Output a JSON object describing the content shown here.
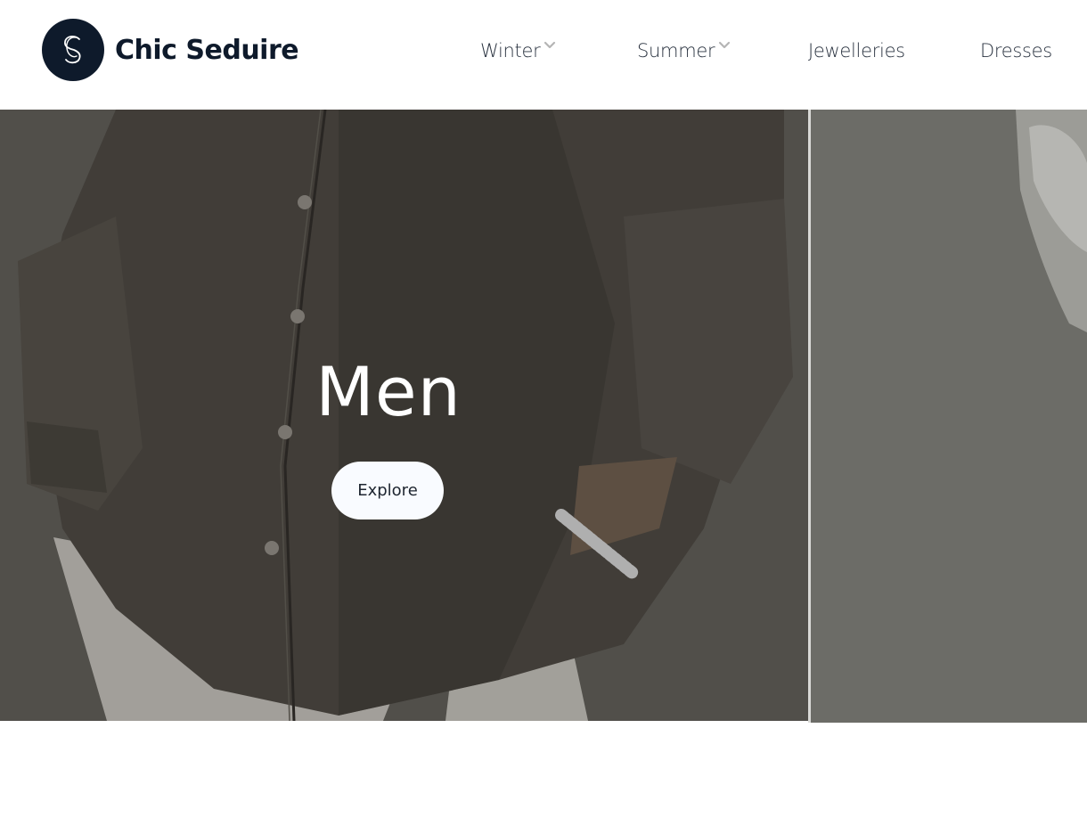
{
  "header": {
    "brand_name": "Chic Seduire",
    "logo_icon": "cs-monogram-icon",
    "colors": {
      "logo_bg": "#0e1a2b",
      "nav_text": "#2a3340",
      "chevron": "#b5b5b5"
    }
  },
  "nav": {
    "items": [
      {
        "label": "Winter",
        "has_dropdown": true,
        "icon": "chevron-down-icon"
      },
      {
        "label": "Summer",
        "has_dropdown": true,
        "icon": "chevron-down-icon"
      },
      {
        "label": "Jewelleries",
        "has_dropdown": false
      },
      {
        "label": "Dresses",
        "has_dropdown": false
      }
    ]
  },
  "hero": {
    "slides": [
      {
        "title": "Men",
        "button_label": "Explore"
      }
    ],
    "colors": {
      "button_bg": "#f9fbff",
      "title_text": "#ffffff"
    }
  }
}
